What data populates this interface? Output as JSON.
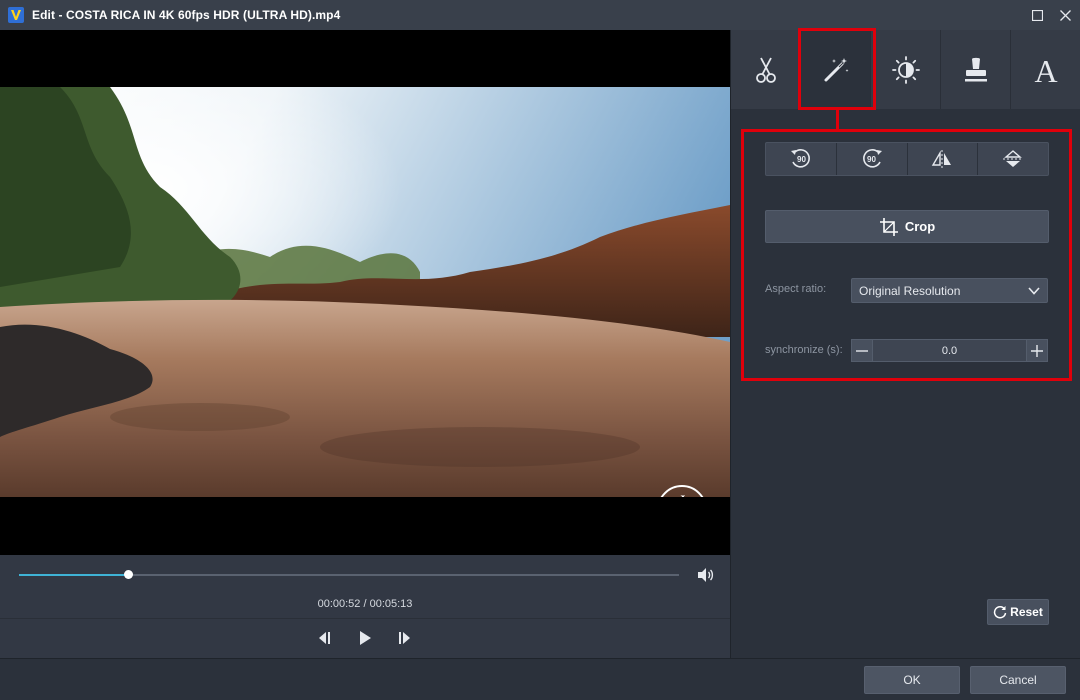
{
  "window": {
    "title": "Edit - COSTA RICA IN 4K 60fps HDR (ULTRA HD).mp4"
  },
  "player": {
    "timecode": "00:00:52 / 00:05:13",
    "progress_fraction": 0.166
  },
  "tabs": [
    {
      "icon": "scissors-icon",
      "active": false
    },
    {
      "icon": "magic-wand-icon",
      "active": true
    },
    {
      "icon": "brightness-icon",
      "active": false
    },
    {
      "icon": "stamp-icon",
      "active": false
    },
    {
      "icon": "text-icon",
      "active": false
    }
  ],
  "rotate": {
    "rotate_left_label": "90",
    "rotate_right_label": "90"
  },
  "crop": {
    "label": "Crop"
  },
  "aspect": {
    "label": "Aspect ratio:",
    "value": "Original Resolution"
  },
  "sync": {
    "label": "synchronize (s):",
    "value": "0.0"
  },
  "watermark": {
    "top_letter": "J",
    "bottom_letter": "K"
  },
  "buttons": {
    "reset": "Reset",
    "ok": "OK",
    "cancel": "Cancel"
  },
  "colors": {
    "highlight": "#e0000b",
    "seek_fill": "#3fb3d6",
    "panel_bg": "#2b313b"
  }
}
